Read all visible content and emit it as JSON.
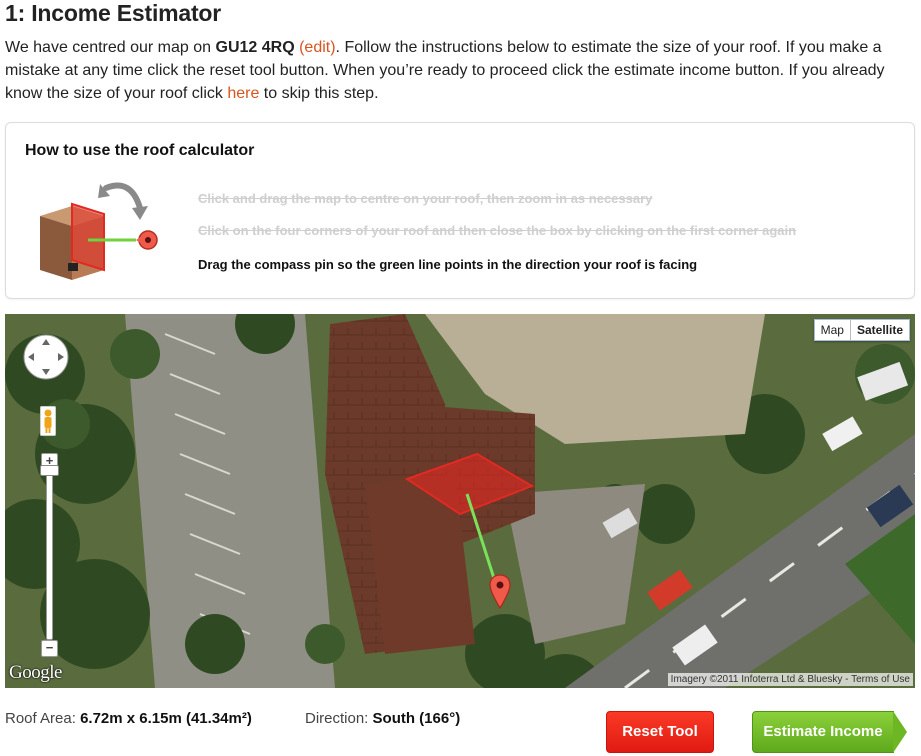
{
  "page": {
    "title": "1: Income Estimator",
    "intro": {
      "part1": "We have centred our map on ",
      "postcode": "GU12 4RQ",
      "edit_link": "(edit)",
      "part2": ". Follow the instructions below to estimate the size of your roof. If you make a mistake at any time click the reset tool button. When you’re ready to proceed click the estimate income button. If you already know the size of your roof click ",
      "here_link": "here",
      "part3": " to skip this step."
    }
  },
  "howto": {
    "heading": "How to use the roof calculator",
    "steps": [
      {
        "text": "Click and drag the map to centre on your roof, then zoom in as necessary",
        "status": "done"
      },
      {
        "text": "Click on the four corners of your roof and then close the box by clicking on the first corner again",
        "status": "done"
      },
      {
        "text": "Drag the compass pin so the green line points in the direction your roof is facing",
        "status": "active"
      }
    ]
  },
  "map": {
    "type_buttons": [
      "Map",
      "Satellite"
    ],
    "selected_type": "Satellite",
    "logo": "Google",
    "attribution": "Imagery ©2011 Infoterra Ltd & Bluesky - Terms of Use",
    "zoom_plus": "+",
    "zoom_minus": "−"
  },
  "stats": {
    "roof_area_label": "Roof Area:",
    "roof_area_value": "6.72m x 6.15m (41.34m²)",
    "direction_label": "Direction:",
    "direction_value": "South (166°)"
  },
  "buttons": {
    "reset": "Reset Tool",
    "estimate": "Estimate Income"
  },
  "colors": {
    "accent_link": "#d9541e",
    "reset_red": "#e01a12",
    "estimate_green": "#5ea91c",
    "roof_polygon": "#e0302a",
    "compass_line": "#7be05a"
  }
}
